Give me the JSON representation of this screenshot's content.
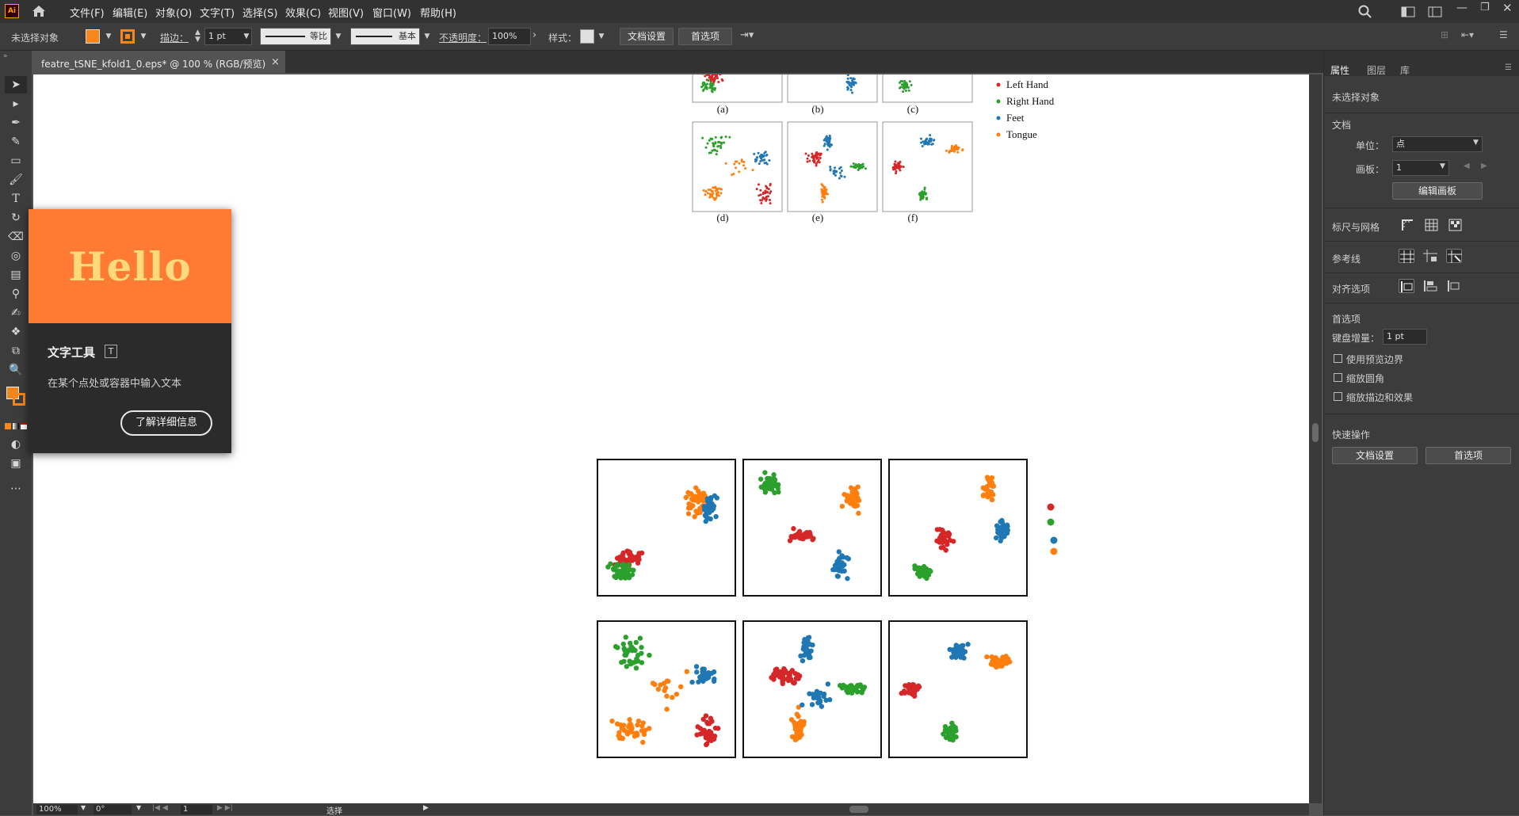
{
  "menubar": {
    "logo": "Ai",
    "items": [
      "文件(F)",
      "编辑(E)",
      "对象(O)",
      "文字(T)",
      "选择(S)",
      "效果(C)",
      "视图(V)",
      "窗口(W)",
      "帮助(H)"
    ]
  },
  "control_bar": {
    "selection": "未选择对象",
    "stroke_label": "描边：",
    "stroke_value": "1 pt",
    "stroke_profile": "等比",
    "brush": "基本",
    "opacity_label": "不透明度：",
    "opacity_value": "100%",
    "style_label": "样式：",
    "doc_settings": "文档设置",
    "preferences": "首选项",
    "fill_color": "#f7861c"
  },
  "tab": {
    "title": "featre_tSNE_kfold1_0.eps* @ 100 % (RGB/预览)",
    "close": "×"
  },
  "tooltip": {
    "hero": "Hello",
    "title": "文字工具",
    "shortcut": "T",
    "description": "在某个点处或容器中输入文本",
    "button": "了解详细信息"
  },
  "right_panel": {
    "tabs": [
      "属性",
      "图层",
      "库"
    ],
    "no_selection": "未选择对象",
    "document": "文档",
    "unit_label": "单位：",
    "unit_value": "点",
    "artboard_label": "画板：",
    "artboard_value": "1",
    "edit_artboard": "编辑画板",
    "rulers_grid": "标尺与网格",
    "guides": "参考线",
    "align_options": "对齐选项",
    "preferences": "首选项",
    "keyboard_increment_label": "键盘增量：",
    "keyboard_increment_value": "1 pt",
    "check_preview_bounds": "使用预览边界",
    "check_scale_corners": "缩放圆角",
    "check_scale_strokes": "缩放描边和效果",
    "quick_actions": "快速操作",
    "doc_settings_btn": "文档设置",
    "prefs_btn": "首选项"
  },
  "status_bar": {
    "zoom": "100%",
    "rotation": "0°",
    "artboard": "1",
    "mode": "选择"
  },
  "figure_top": {
    "row1_labels": [
      "(a)",
      "(b)",
      "(c)"
    ],
    "row2_labels": [
      "(d)",
      "(e)",
      "(f)"
    ],
    "legend": [
      "Left Hand",
      "Right Hand",
      "Feet",
      "Tongue"
    ],
    "colors": {
      "left_hand": "#d62728",
      "right_hand": "#2ca02c",
      "feet": "#1f77b4",
      "tongue": "#ff7f0e"
    }
  },
  "figure_bottom": {
    "legend_colors": [
      "#d62728",
      "#2ca02c",
      "#1f77b4",
      "#ff7f0e"
    ]
  }
}
